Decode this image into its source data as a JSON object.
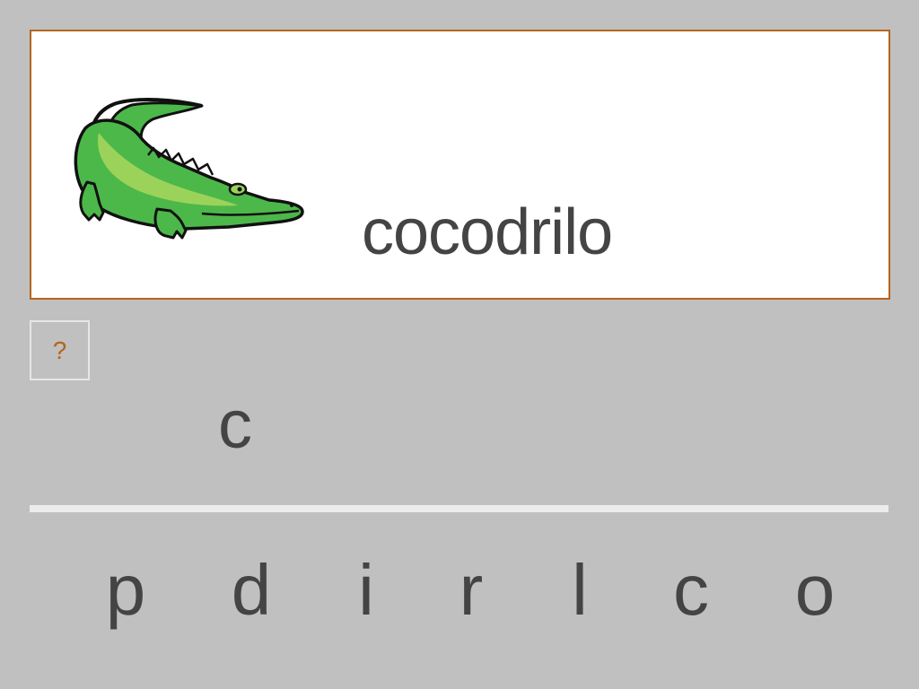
{
  "card": {
    "image_name": "crocodile",
    "word": "cocodrilo"
  },
  "hint": {
    "label": "?"
  },
  "answer": {
    "letters": [
      "c"
    ]
  },
  "tiles": [
    "p",
    "d",
    "i",
    "r",
    "l",
    "c",
    "o"
  ],
  "colors": {
    "background": "#c0c0c0",
    "card_border": "#b5651d",
    "text": "#444444",
    "hint": "#b5651d",
    "croc_body": "#4cb84a",
    "croc_belly": "#9bd35a"
  }
}
